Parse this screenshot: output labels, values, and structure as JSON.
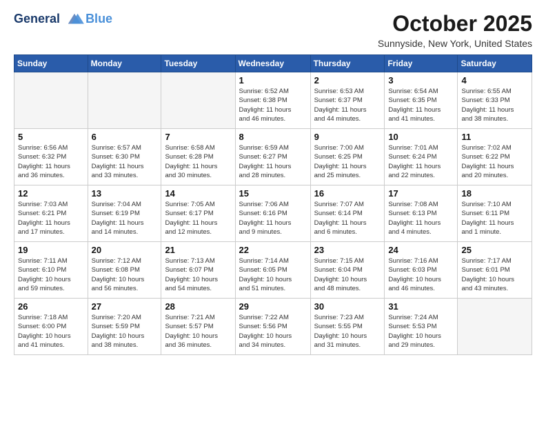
{
  "header": {
    "logo_line1": "General",
    "logo_line2": "Blue",
    "month_year": "October 2025",
    "location": "Sunnyside, New York, United States"
  },
  "days_of_week": [
    "Sunday",
    "Monday",
    "Tuesday",
    "Wednesday",
    "Thursday",
    "Friday",
    "Saturday"
  ],
  "weeks": [
    [
      {
        "day": "",
        "info": ""
      },
      {
        "day": "",
        "info": ""
      },
      {
        "day": "",
        "info": ""
      },
      {
        "day": "1",
        "info": "Sunrise: 6:52 AM\nSunset: 6:38 PM\nDaylight: 11 hours\nand 46 minutes."
      },
      {
        "day": "2",
        "info": "Sunrise: 6:53 AM\nSunset: 6:37 PM\nDaylight: 11 hours\nand 44 minutes."
      },
      {
        "day": "3",
        "info": "Sunrise: 6:54 AM\nSunset: 6:35 PM\nDaylight: 11 hours\nand 41 minutes."
      },
      {
        "day": "4",
        "info": "Sunrise: 6:55 AM\nSunset: 6:33 PM\nDaylight: 11 hours\nand 38 minutes."
      }
    ],
    [
      {
        "day": "5",
        "info": "Sunrise: 6:56 AM\nSunset: 6:32 PM\nDaylight: 11 hours\nand 36 minutes."
      },
      {
        "day": "6",
        "info": "Sunrise: 6:57 AM\nSunset: 6:30 PM\nDaylight: 11 hours\nand 33 minutes."
      },
      {
        "day": "7",
        "info": "Sunrise: 6:58 AM\nSunset: 6:28 PM\nDaylight: 11 hours\nand 30 minutes."
      },
      {
        "day": "8",
        "info": "Sunrise: 6:59 AM\nSunset: 6:27 PM\nDaylight: 11 hours\nand 28 minutes."
      },
      {
        "day": "9",
        "info": "Sunrise: 7:00 AM\nSunset: 6:25 PM\nDaylight: 11 hours\nand 25 minutes."
      },
      {
        "day": "10",
        "info": "Sunrise: 7:01 AM\nSunset: 6:24 PM\nDaylight: 11 hours\nand 22 minutes."
      },
      {
        "day": "11",
        "info": "Sunrise: 7:02 AM\nSunset: 6:22 PM\nDaylight: 11 hours\nand 20 minutes."
      }
    ],
    [
      {
        "day": "12",
        "info": "Sunrise: 7:03 AM\nSunset: 6:21 PM\nDaylight: 11 hours\nand 17 minutes."
      },
      {
        "day": "13",
        "info": "Sunrise: 7:04 AM\nSunset: 6:19 PM\nDaylight: 11 hours\nand 14 minutes."
      },
      {
        "day": "14",
        "info": "Sunrise: 7:05 AM\nSunset: 6:17 PM\nDaylight: 11 hours\nand 12 minutes."
      },
      {
        "day": "15",
        "info": "Sunrise: 7:06 AM\nSunset: 6:16 PM\nDaylight: 11 hours\nand 9 minutes."
      },
      {
        "day": "16",
        "info": "Sunrise: 7:07 AM\nSunset: 6:14 PM\nDaylight: 11 hours\nand 6 minutes."
      },
      {
        "day": "17",
        "info": "Sunrise: 7:08 AM\nSunset: 6:13 PM\nDaylight: 11 hours\nand 4 minutes."
      },
      {
        "day": "18",
        "info": "Sunrise: 7:10 AM\nSunset: 6:11 PM\nDaylight: 11 hours\nand 1 minute."
      }
    ],
    [
      {
        "day": "19",
        "info": "Sunrise: 7:11 AM\nSunset: 6:10 PM\nDaylight: 10 hours\nand 59 minutes."
      },
      {
        "day": "20",
        "info": "Sunrise: 7:12 AM\nSunset: 6:08 PM\nDaylight: 10 hours\nand 56 minutes."
      },
      {
        "day": "21",
        "info": "Sunrise: 7:13 AM\nSunset: 6:07 PM\nDaylight: 10 hours\nand 54 minutes."
      },
      {
        "day": "22",
        "info": "Sunrise: 7:14 AM\nSunset: 6:05 PM\nDaylight: 10 hours\nand 51 minutes."
      },
      {
        "day": "23",
        "info": "Sunrise: 7:15 AM\nSunset: 6:04 PM\nDaylight: 10 hours\nand 48 minutes."
      },
      {
        "day": "24",
        "info": "Sunrise: 7:16 AM\nSunset: 6:03 PM\nDaylight: 10 hours\nand 46 minutes."
      },
      {
        "day": "25",
        "info": "Sunrise: 7:17 AM\nSunset: 6:01 PM\nDaylight: 10 hours\nand 43 minutes."
      }
    ],
    [
      {
        "day": "26",
        "info": "Sunrise: 7:18 AM\nSunset: 6:00 PM\nDaylight: 10 hours\nand 41 minutes."
      },
      {
        "day": "27",
        "info": "Sunrise: 7:20 AM\nSunset: 5:59 PM\nDaylight: 10 hours\nand 38 minutes."
      },
      {
        "day": "28",
        "info": "Sunrise: 7:21 AM\nSunset: 5:57 PM\nDaylight: 10 hours\nand 36 minutes."
      },
      {
        "day": "29",
        "info": "Sunrise: 7:22 AM\nSunset: 5:56 PM\nDaylight: 10 hours\nand 34 minutes."
      },
      {
        "day": "30",
        "info": "Sunrise: 7:23 AM\nSunset: 5:55 PM\nDaylight: 10 hours\nand 31 minutes."
      },
      {
        "day": "31",
        "info": "Sunrise: 7:24 AM\nSunset: 5:53 PM\nDaylight: 10 hours\nand 29 minutes."
      },
      {
        "day": "",
        "info": ""
      }
    ]
  ]
}
